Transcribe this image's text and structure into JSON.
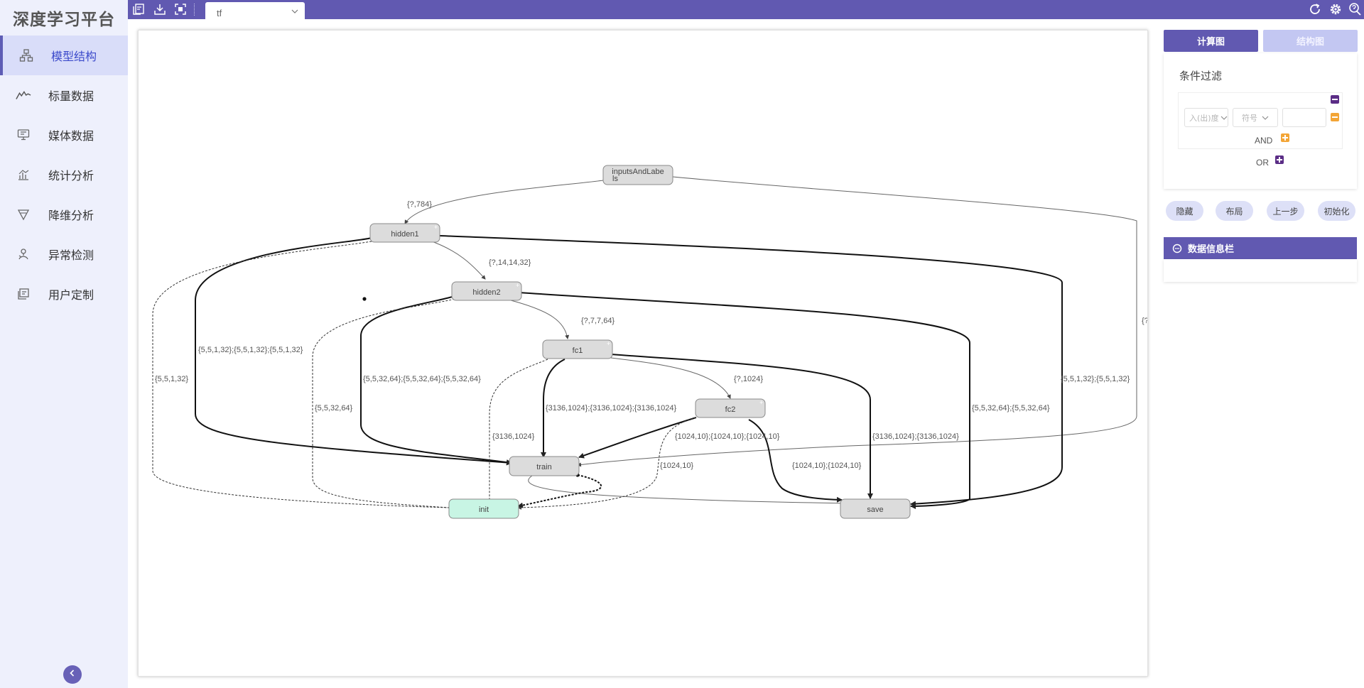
{
  "app": {
    "title": "深度学习平台"
  },
  "sidebar": {
    "items": [
      {
        "label": "模型结构",
        "icon": "hierarchy-icon",
        "active": true
      },
      {
        "label": "标量数据",
        "icon": "line-chart-icon",
        "active": false
      },
      {
        "label": "媒体数据",
        "icon": "monitor-icon",
        "active": false
      },
      {
        "label": "统计分析",
        "icon": "bar-chart-icon",
        "active": false
      },
      {
        "label": "降维分析",
        "icon": "funnel-icon",
        "active": false
      },
      {
        "label": "异常检测",
        "icon": "anomaly-icon",
        "active": false
      },
      {
        "label": "用户定制",
        "icon": "custom-icon",
        "active": false
      }
    ],
    "collapse_icon": "chevron-left-icon"
  },
  "topbar": {
    "icons": [
      "import-icon",
      "download-icon",
      "fullscreen-icon",
      "refresh-icon",
      "settings-icon",
      "help-icon"
    ],
    "tab": {
      "label": "tf"
    }
  },
  "graph": {
    "nodes": [
      {
        "id": "inputsAndLabels",
        "line1": "inputsAndLabe",
        "line2": "ls"
      },
      {
        "id": "hidden1",
        "label": "hidden1"
      },
      {
        "id": "hidden2",
        "label": "hidden2"
      },
      {
        "id": "fc1",
        "label": "fc1"
      },
      {
        "id": "fc2",
        "label": "fc2"
      },
      {
        "id": "train",
        "label": "train"
      },
      {
        "id": "init",
        "label": "init"
      },
      {
        "id": "save",
        "label": "save"
      }
    ],
    "edge_labels": [
      "{?,784}",
      "{?,14,14,32}",
      "{?,7,7,64}",
      "{?,1024}",
      "{5,5,1,32};{5,5,1,32};{5,5,1,32}",
      "{5,5,1,32}",
      "{5,5,32,64};{5,5,32,64};{5,5,32,64}",
      "{5,5,32,64}",
      "{3136,1024};{3136,1024};{3136,1024}",
      "{3136,1024}",
      "{1024,10};{1024,10};{1024,10}",
      "{1024,10}",
      "{1024,10};{1024,10}",
      "{3136,1024};{3136,1024}",
      "{5,5,32,64};{5,5,32,64}",
      "{5,5,1,32};{5,5,1,32}",
      "{?"
    ]
  },
  "right_panel": {
    "view_buttons": {
      "compute": "计算图",
      "structure": "结构图"
    },
    "filter": {
      "title": "条件过滤",
      "degree_placeholder": "入(出)度",
      "symbol_placeholder": "符号",
      "and_label": "AND",
      "or_label": "OR"
    },
    "actions": [
      "隐藏",
      "布局",
      "上一步",
      "初始化"
    ],
    "info": {
      "title": "数据信息栏"
    }
  },
  "colors": {
    "accent": "#6159b1",
    "sidebar_bg": "#eef0fc",
    "node_fill": "#dcdcdc",
    "init_fill": "#c8f5e4",
    "remove": "#5b2d86",
    "add": "#f3a536"
  }
}
